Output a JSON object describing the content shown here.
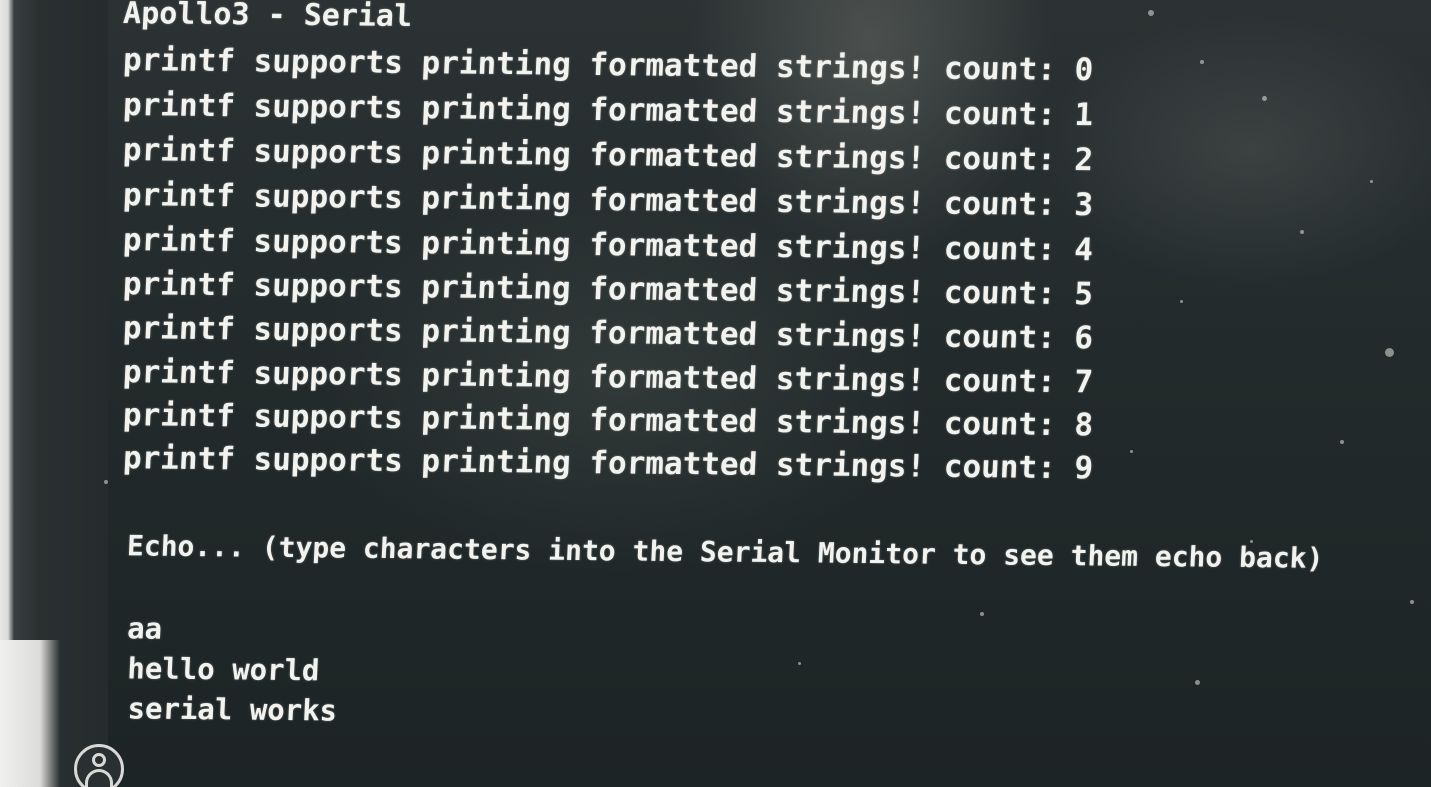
{
  "window": {
    "title": "Apollo3 - Serial"
  },
  "serial_output": {
    "printf_lines": [
      "printf supports printing formatted strings! count: 0",
      "printf supports printing formatted strings! count: 1",
      "printf supports printing formatted strings! count: 2",
      "printf supports printing formatted strings! count: 3",
      "printf supports printing formatted strings! count: 4",
      "printf supports printing formatted strings! count: 5",
      "printf supports printing formatted strings! count: 6",
      "printf supports printing formatted strings! count: 7",
      "printf supports printing formatted strings! count: 8",
      "printf supports printing formatted strings! count: 9"
    ],
    "echo_prompt": "Echo... (type characters into the Serial Monitor to see them echo back)",
    "echoed_lines": [
      "aa",
      "hello world",
      "serial works"
    ]
  },
  "icons": {
    "bottom_left": "user-avatar-icon"
  },
  "colors": {
    "background": "#222a2b",
    "text": "#f2f2ee"
  }
}
